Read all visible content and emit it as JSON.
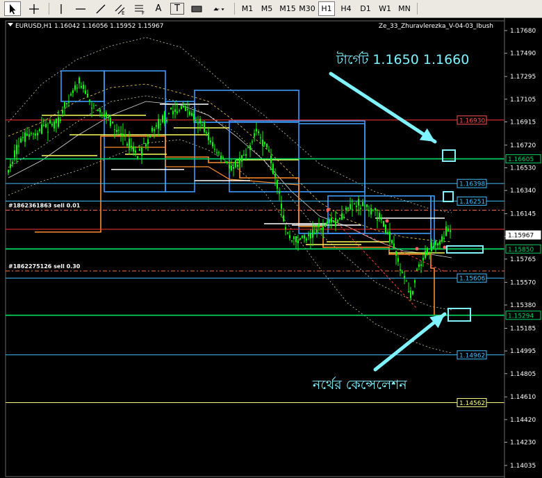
{
  "toolbar": {
    "tools": [
      {
        "name": "cursor-arrow-icon",
        "label": ""
      },
      {
        "name": "crosshair-icon",
        "label": ""
      },
      {
        "name": "vertical-line-icon",
        "label": ""
      },
      {
        "name": "horizontal-line-icon",
        "label": ""
      },
      {
        "name": "trendline-icon",
        "label": ""
      },
      {
        "name": "equidistant-channel-icon",
        "label": "E"
      },
      {
        "name": "fibonacci-icon",
        "label": "F"
      },
      {
        "name": "text-icon",
        "label": "A"
      },
      {
        "name": "text-label-icon",
        "label": "T"
      },
      {
        "name": "rectangle-icon",
        "label": ""
      },
      {
        "name": "arrows-dropdown-icon",
        "label": ""
      }
    ],
    "timeframes": [
      "M1",
      "M5",
      "M15",
      "M30",
      "H1",
      "H4",
      "D1",
      "W1",
      "MN"
    ],
    "active_timeframe": "H1"
  },
  "chart": {
    "header": "EURUSD,H1  1.16042 1.16056 1.15952 1.15967",
    "indicator_name": "Ze_33_Zhuravlerezka_V-04-03_Ibush",
    "price_scale": [
      "1.17680",
      "1.17490",
      "1.17295",
      "1.17105",
      "1.16915",
      "1.16720",
      "1.16530",
      "1.16340",
      "1.16145",
      "1.15955",
      "1.15765",
      "1.15570",
      "1.15380",
      "1.15185",
      "1.14995",
      "1.14805",
      "1.14610",
      "1.14420",
      "1.14230",
      "1.14035"
    ],
    "price_labels": [
      {
        "text": "1.16930",
        "color": "#ff5050"
      },
      {
        "text": "1.16605",
        "color": "#00d060"
      },
      {
        "text": "1.16398",
        "color": "#40c0ff"
      },
      {
        "text": "1.16251",
        "color": "#40c0ff"
      },
      {
        "text": "1.15967",
        "color": "#ffffff"
      },
      {
        "text": "1.15850",
        "color": "#00d060"
      },
      {
        "text": "1.15606",
        "color": "#40c0ff"
      },
      {
        "text": "1.15294",
        "color": "#00d060"
      },
      {
        "text": "1.14962",
        "color": "#40c0ff"
      },
      {
        "text": "1.14562",
        "color": "#ffff80"
      }
    ],
    "orders": [
      {
        "text": "#1862361863 sell 0.01"
      },
      {
        "text": "#1862275126 sell 0.30"
      }
    ],
    "annotation_target": "টার্গেট 1.1650 1.1660",
    "annotation_cancel": "নর্থের কেন্সেলেশন",
    "colors": {
      "candle": "#00ff00",
      "support": "#00d060",
      "resistance": "#ff3030",
      "blue_box": "#3c9bff",
      "orange_line": "#ff8c2a",
      "yellow_line": "#ffff60",
      "annotation": "#7ff3ff"
    }
  }
}
